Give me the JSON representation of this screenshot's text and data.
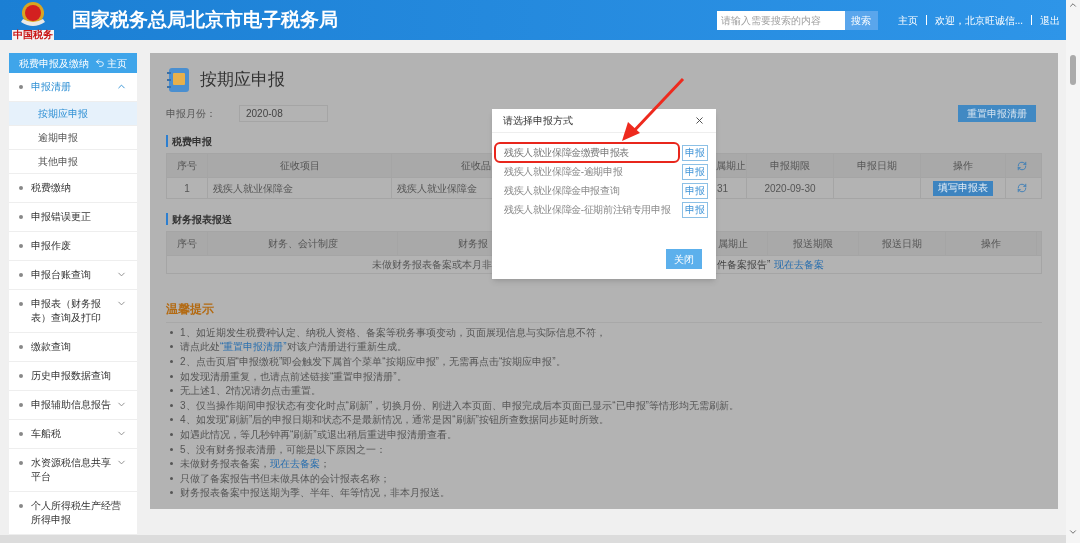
{
  "header": {
    "logo_text": "中国税务",
    "title": "国家税务总局北京市电子税务局",
    "search": {
      "placeholder": "请输入需要搜索的内容",
      "button": "搜索"
    },
    "links": [
      "主页",
      "欢迎，北京旺诚信...",
      "退出"
    ]
  },
  "sidebar": {
    "title": "税费申报及缴纳",
    "home_link": "主页",
    "items": [
      {
        "label": "申报清册",
        "expanded": true,
        "children": [
          {
            "label": "按期应申报",
            "selected": true
          },
          {
            "label": "逾期申报",
            "selected": false
          },
          {
            "label": "其他申报",
            "selected": false
          }
        ]
      },
      {
        "label": "税费缴纳"
      },
      {
        "label": "申报错误更正"
      },
      {
        "label": "申报作废"
      },
      {
        "label": "申报台账查询",
        "expanded": false
      },
      {
        "label": "申报表（财务报表）查询及打印",
        "expanded": false
      },
      {
        "label": "缴款查询"
      },
      {
        "label": "历史申报数据查询"
      },
      {
        "label": "申报辅助信息报告",
        "expanded": false
      },
      {
        "label": "车船税",
        "expanded": false
      },
      {
        "label": "水资源税信息共享平台",
        "expanded": false
      },
      {
        "label": "个人所得税生产经营所得申报"
      }
    ]
  },
  "page": {
    "title": "按期应申报",
    "month": {
      "label": "申报月份：",
      "value": "2020-08"
    },
    "reset_button": "重置申报清册",
    "tax_section": {
      "title": "税费申报",
      "columns": [
        "序号",
        "征收项目",
        "征收品",
        "属期止",
        "申报期限",
        "申报日期",
        "操作"
      ],
      "rows": [
        {
          "number": "1",
          "item": "残疾人就业保障金",
          "category": "残疾人就业保障金",
          "period_end": "31",
          "deadline": "2020-09-30",
          "action": "填写申报表"
        }
      ]
    },
    "report_section": {
      "title": "财务报表报送",
      "columns": [
        "序号",
        "财务、会计制度",
        "财务报",
        "属期止",
        "报送期限",
        "报送日期",
        "操作"
      ],
      "message": {
        "left": "未做财务报表备案或本月非",
        "right": "件备案报告”",
        "link": "现在去备案"
      }
    },
    "tips": {
      "title": "温馨提示",
      "items": [
        {
          "parts": [
            {
              "kind": "text",
              "text": "1、如近期发生税费种认定、纳税人资格、备案等税务事项变动，页面展现信息与实际信息不符，"
            }
          ]
        },
        {
          "parts": [
            {
              "kind": "text",
              "text": "请点此处"
            },
            {
              "kind": "link",
              "text": "“重置申报清册”"
            },
            {
              "kind": "text",
              "text": "对该户清册进行重新生成。"
            }
          ]
        },
        {
          "parts": [
            {
              "kind": "text",
              "text": "2、点击页眉“申报缴税”即会触发下属首个菜单“按期应申报”，无需再点击“按期应申报”。"
            }
          ]
        },
        {
          "parts": [
            {
              "kind": "text",
              "text": "如发现清册重复，也请点前述链接“重置申报清册”。"
            }
          ]
        },
        {
          "parts": [
            {
              "kind": "text",
              "text": "无上述1、2情况请勿点击重置。"
            }
          ]
        },
        {
          "parts": [
            {
              "kind": "text",
              "text": "3、仅当操作期间申报状态有变化时点“刷新”，切换月份、刚进入本页面、申报完成后本页面已显示“已申报”等情形均无需刷新。"
            }
          ]
        },
        {
          "parts": [
            {
              "kind": "text",
              "text": "4、如发现“刷新”后的申报日期和状态不是最新情况，通常是因“刷新”按钮所查数据同步延时所致。"
            }
          ]
        },
        {
          "parts": [
            {
              "kind": "text",
              "text": "如遇此情况，等几秒钟再“刷新”或退出稍后重进申报清册查看。"
            }
          ]
        },
        {
          "parts": [
            {
              "kind": "text",
              "text": "5、没有财务报表清册，可能是以下原因之一："
            }
          ]
        },
        {
          "parts": [
            {
              "kind": "text",
              "text": "未做财务报表备案，"
            },
            {
              "kind": "link",
              "text": "现在去备案"
            },
            {
              "kind": "text",
              "text": "；"
            }
          ]
        },
        {
          "parts": [
            {
              "kind": "text",
              "text": "只做了备案报告书但未做具体的会计报表名称；"
            }
          ]
        },
        {
          "parts": [
            {
              "kind": "text",
              "text": "财务报表备案中报送期为季、半年、年等情况，非本月报送。"
            }
          ]
        }
      ]
    }
  },
  "modal": {
    "title": "请选择申报方式",
    "options": [
      {
        "label": "残疾人就业保障金缴费申报表",
        "button": "申报",
        "highlighted": true
      },
      {
        "label": "残疾人就业保障金-逾期申报",
        "button": "申报",
        "highlighted": false
      },
      {
        "label": "残疾人就业保障金申报查询",
        "button": "申报",
        "highlighted": false
      },
      {
        "label": "残疾人就业保障金-征期前注销专用申报",
        "button": "申报",
        "highlighted": false
      }
    ],
    "close_button": "关闭"
  }
}
